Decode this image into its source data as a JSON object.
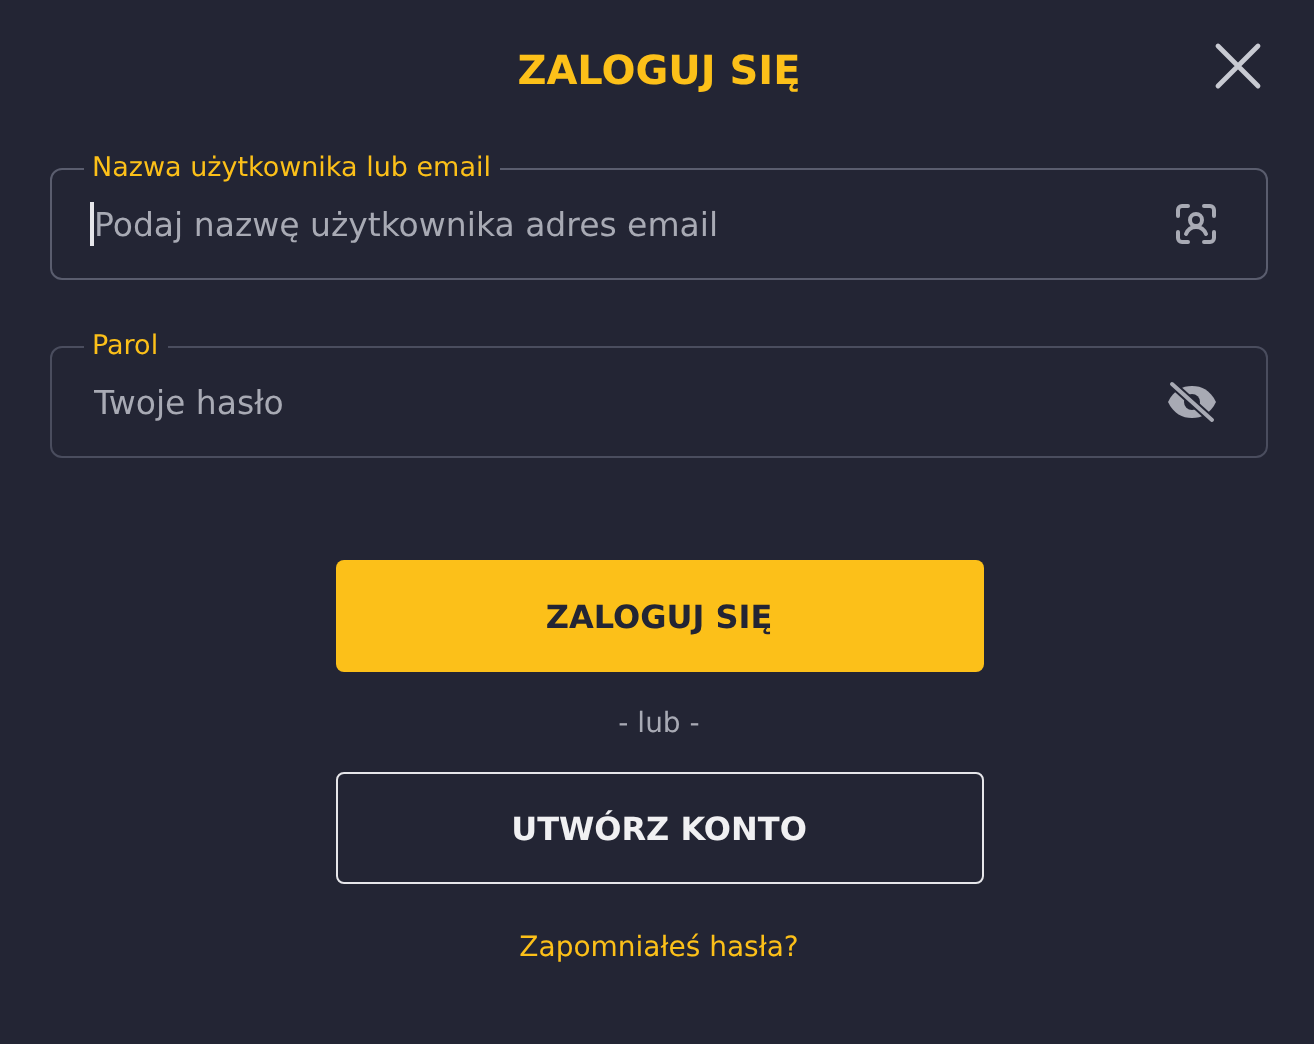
{
  "dialog": {
    "title": "ZALOGUJ SIĘ"
  },
  "fields": [
    {
      "kind": "username",
      "label": "Nazwa użytkownika lub email",
      "placeholder": "Podaj nazwę użytkownika adres email",
      "focused": true
    },
    {
      "kind": "password",
      "label": "Parol",
      "placeholder": "Twoje hasło",
      "focused": false
    }
  ],
  "login_button": "ZALOGUJ SIĘ",
  "separator": "- lub -",
  "register_button": "UTWÓRZ KONTO",
  "forgot_link": "Zapomniałeś hasła?"
}
